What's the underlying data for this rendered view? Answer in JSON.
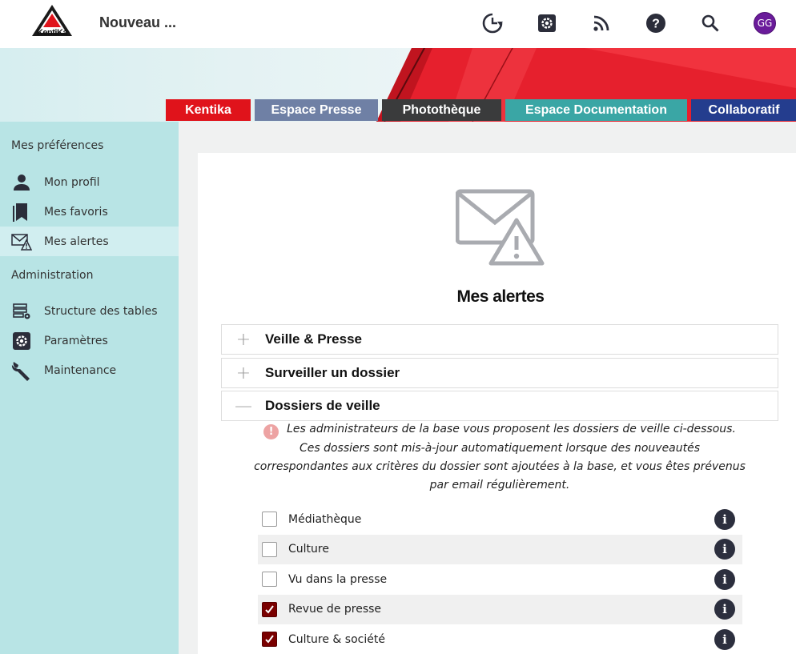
{
  "app": {
    "logo_text": "KentiKa",
    "title": "Nouveau ...",
    "avatar_initials": "GG",
    "avatar_color": "#6a1b9a"
  },
  "header_icons": [
    {
      "name": "history-icon"
    },
    {
      "name": "settings-icon"
    },
    {
      "name": "rss-icon"
    },
    {
      "name": "help-icon"
    },
    {
      "name": "search-icon"
    }
  ],
  "tabs": [
    {
      "label": "Kentika",
      "color": "#e0131b"
    },
    {
      "label": "Espace Presse",
      "color": "#6f80a5"
    },
    {
      "label": "Photothèque",
      "color": "#3a3b3c"
    },
    {
      "label": "Espace Documentation",
      "color": "#3aa6a5"
    },
    {
      "label": "Collaboratif",
      "color": "#243d8e"
    }
  ],
  "sidebar": {
    "preferences_heading": "Mes préférences",
    "preferences": [
      {
        "label": "Mon profil",
        "icon": "user-icon"
      },
      {
        "label": "Mes favoris",
        "icon": "bookmarks-icon"
      },
      {
        "label": "Mes alertes",
        "icon": "mail-alert-icon",
        "active": true
      }
    ],
    "admin_heading": "Administration",
    "admin": [
      {
        "label": "Structure des tables",
        "icon": "table-structure-icon"
      },
      {
        "label": "Paramètres",
        "icon": "settings-icon"
      },
      {
        "label": "Maintenance",
        "icon": "wrench-icon"
      }
    ]
  },
  "main": {
    "title": "Mes alertes",
    "accordion": [
      {
        "title": "Veille & Presse",
        "sign": "+",
        "expanded": false
      },
      {
        "title": "Surveiller un dossier",
        "sign": "+",
        "expanded": false
      },
      {
        "title": "Dossiers de veille",
        "sign": "—",
        "expanded": true
      }
    ],
    "notice": "Les administrateurs de la base vous proposent les dossiers de veille ci-dessous. Ces dossiers sont mis-à-jour automatiquement lorsque des nouveautés correspondantes aux critères du dossier sont ajoutées à la base, et vous êtes prévenus par email régulièrement.",
    "folders": [
      {
        "label": "Médiathèque",
        "checked": false
      },
      {
        "label": "Culture",
        "checked": false
      },
      {
        "label": "Vu dans la presse",
        "checked": false
      },
      {
        "label": "Revue de presse",
        "checked": true
      },
      {
        "label": "Culture & société",
        "checked": true
      }
    ],
    "info_glyph": "i",
    "check_glyph": "✓"
  }
}
